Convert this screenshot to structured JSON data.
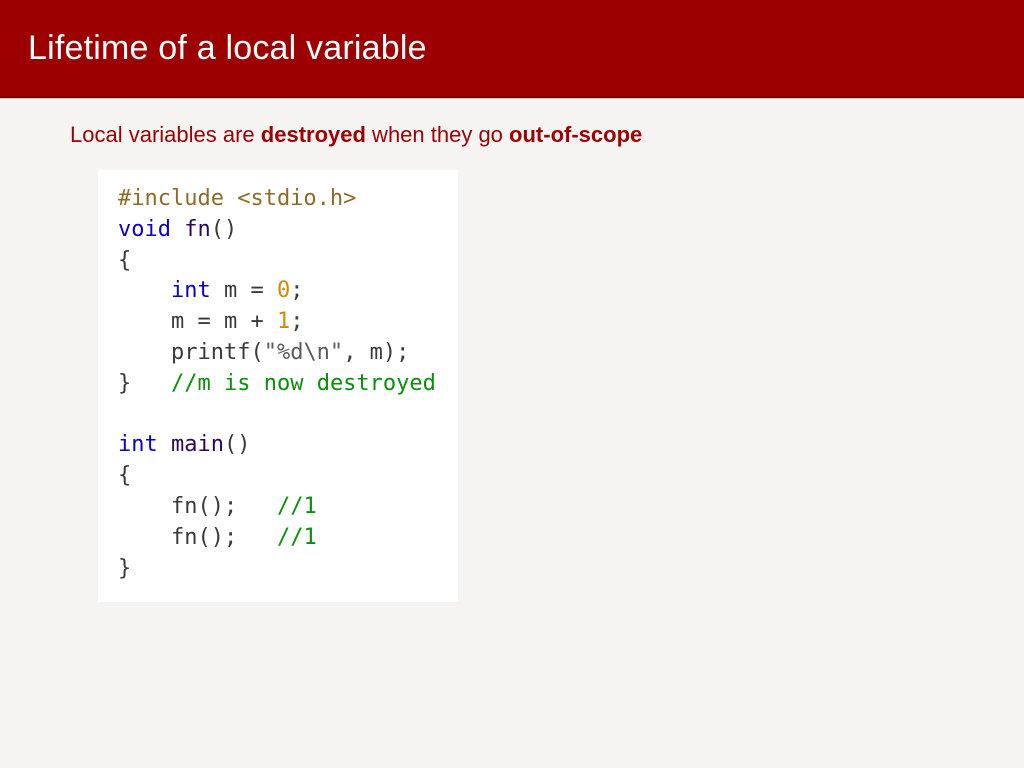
{
  "header": {
    "title": "Lifetime of a local variable"
  },
  "lead": {
    "pre": "Local variables are ",
    "bold1": "destroyed",
    "mid": " when they go ",
    "bold2": "out-of-scope"
  },
  "code": {
    "l1_include": "#include <stdio.h>",
    "l2_kw": "void",
    "l2_sp": " ",
    "l2_fn": "fn",
    "l2_rest": "()",
    "l3": "{",
    "l4_indent": "    ",
    "l4_kw": "int",
    "l4_mid": " m = ",
    "l4_num": "0",
    "l4_end": ";",
    "l5": "    m = m + ",
    "l5_num": "1",
    "l5_end": ";",
    "l6_pre": "    printf(",
    "l6_str": "\"%d\\n\"",
    "l6_post": ", m);",
    "l7_brace": "}",
    "l7_sp": "   ",
    "l7_com": "//m is now destroyed",
    "l8": "",
    "l9_kw": "int",
    "l9_sp": " ",
    "l9_fn": "main",
    "l9_rest": "()",
    "l10": "{",
    "l11_call": "    fn();   ",
    "l11_com": "//1",
    "l12_call": "    fn();   ",
    "l12_com": "//1",
    "l13": "}"
  }
}
